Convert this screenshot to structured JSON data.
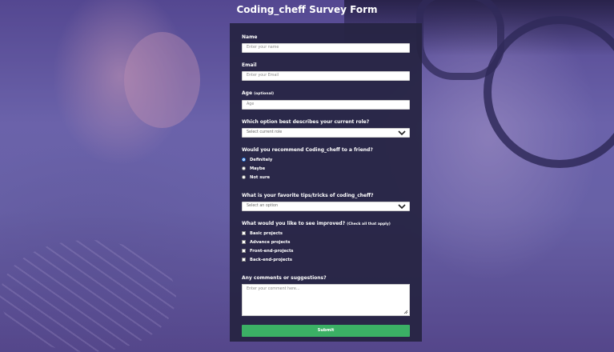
{
  "page": {
    "title": "Coding_cheff Survey Form"
  },
  "form": {
    "name": {
      "label": "Name",
      "placeholder": "Enter your name"
    },
    "email": {
      "label": "Email",
      "placeholder": "Enter your Email"
    },
    "age": {
      "label": "Age",
      "optional": "(optional)",
      "placeholder": "Age"
    },
    "role": {
      "label": "Which option best describes your current role?",
      "selected": "Select current role"
    },
    "recommend": {
      "label": "Would you recommend Coding_cheff to a friend?",
      "options": [
        "Definitely",
        "Maybe",
        "Not sure"
      ],
      "selected_index": 0
    },
    "tips": {
      "label": "What is your favorite tips/tricks of coding_cheff?",
      "selected": "Select an option"
    },
    "improve": {
      "label": "What would you like to see improved?",
      "hint": "(Check all that apply)",
      "options": [
        "Basic projects",
        "Advance projects",
        "Front-end-projects",
        "Back-end-projects"
      ]
    },
    "comments": {
      "label": "Any comments or suggestions?",
      "placeholder": "Enter your comment here..."
    },
    "submit_label": "Submit"
  },
  "colors": {
    "form_bg": "#26244299",
    "submit": "#3bb065",
    "radio_checked": "#1e6fd8"
  },
  "icons": {
    "select_arrow": "chevron-down-icon",
    "textarea_resize": "resize-handle-icon"
  }
}
